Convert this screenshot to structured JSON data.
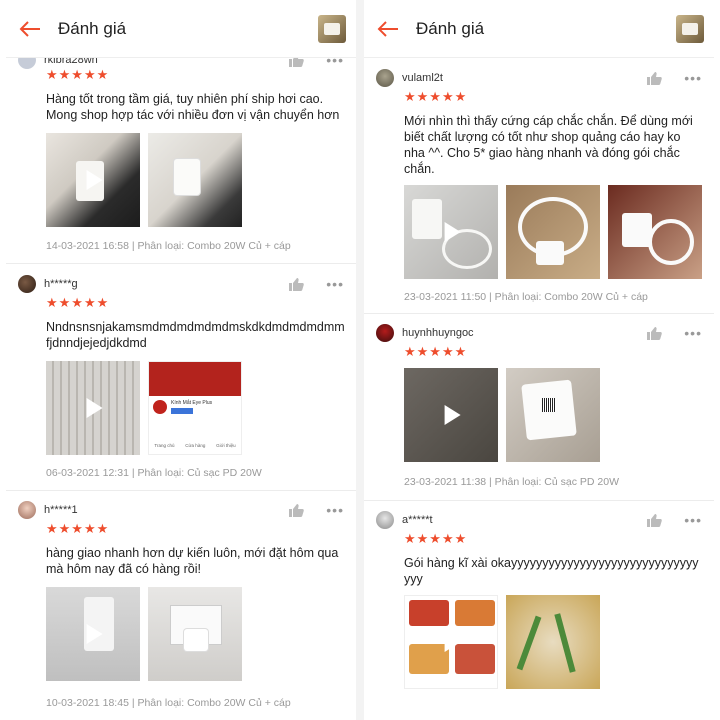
{
  "left": {
    "header_title": "Đánh giá",
    "reviews": [
      {
        "user": "rkibra28wn",
        "text": "Hàng tốt trong tầm giá, tuy nhiên phí ship hơi cao. Mong shop hợp tác với nhiều đơn vị vận chuyển hơn",
        "meta": "14-03-2021 16:58 | Phân loại: Combo 20W Củ + cáp"
      },
      {
        "user": "h*****g",
        "text": "Nndnsnsnjakamsmdmdmdmdmdmskdkdmdmdmdmmfjdnndjejedjdkdmd",
        "meta": "06-03-2021 12:31 | Phân loại: Củ sạc PD 20W",
        "shop_card": {
          "name": "Kính Mắt Eye Plus",
          "tabs": [
            "Trang chủ",
            "Cửa hàng",
            "Giới thiệu"
          ]
        }
      },
      {
        "user": "h*****1",
        "text": "hàng giao nhanh hơn dự kiến luôn, mới đặt hôm qua mà hôm nay đã có hàng rồi!",
        "meta": "10-03-2021 18:45 | Phân loại: Combo 20W Củ + cáp"
      }
    ]
  },
  "right": {
    "header_title": "Đánh giá",
    "reviews": [
      {
        "user": "vulaml2t",
        "text": "Mới nhìn thì thấy cứng cáp chắc chắn. Để dùng mới biết chất lượng có tốt như shop quảng cáo hay ko nha ^^. Cho 5* giao hàng nhanh và đóng gói chắc chắn.",
        "meta": "23-03-2021 11:50 | Phân loại: Combo 20W Củ + cáp"
      },
      {
        "user": "huynhhuyngoc",
        "text": "",
        "meta": "23-03-2021 11:38 | Phân loại: Củ sạc PD 20W"
      },
      {
        "user": "a*****t",
        "text": "Gói hàng kĩ xài okayyyyyyyyyyyyyyyyyyyyyyyyyyyyyyyyy",
        "meta": ""
      }
    ]
  },
  "stars": "★★★★★",
  "more": "•••",
  "colors": {
    "accent": "#ee4d2d",
    "muted": "#999999"
  }
}
